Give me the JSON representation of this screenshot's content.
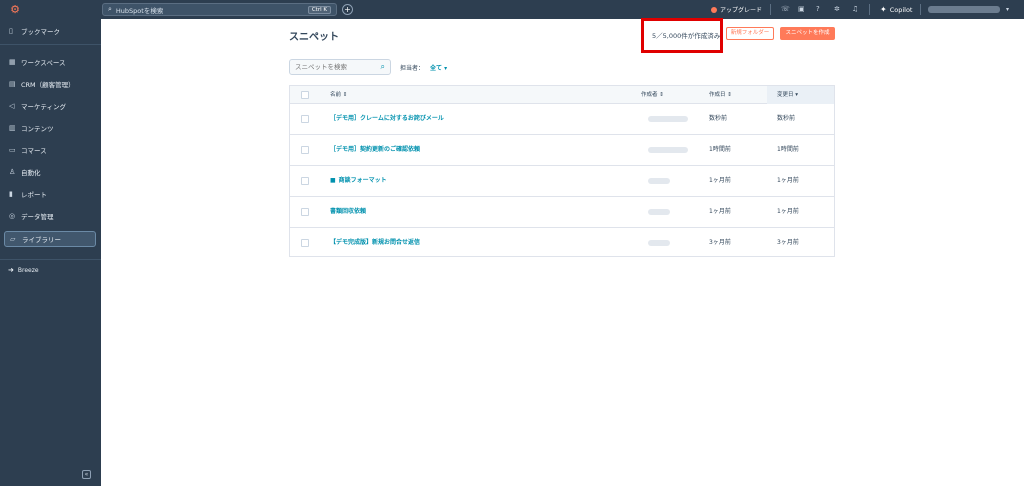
{
  "topbar": {
    "search_placeholder": "HubSpotを検索",
    "search_shortcut": "Ctrl K",
    "upgrade_label": "アップグレード",
    "copilot_label": "Copilot"
  },
  "sidebar": {
    "items": [
      {
        "label": "ブックマーク",
        "icon": "bookmark-icon"
      },
      {
        "label": "ワークスペース",
        "icon": "grid-icon"
      },
      {
        "label": "CRM（顧客管理）",
        "icon": "crm-icon"
      },
      {
        "label": "マーケティング",
        "icon": "megaphone-icon"
      },
      {
        "label": "コンテンツ",
        "icon": "content-icon"
      },
      {
        "label": "コマース",
        "icon": "commerce-icon"
      },
      {
        "label": "自動化",
        "icon": "automation-icon"
      },
      {
        "label": "レポート",
        "icon": "chart-icon"
      },
      {
        "label": "データ管理",
        "icon": "database-icon"
      },
      {
        "label": "ライブラリー",
        "icon": "folder-icon",
        "active": true
      }
    ],
    "breeze_label": "Breeze"
  },
  "main": {
    "title": "スニペット",
    "created_count": "5／5,000件が作成済み",
    "new_folder_label": "新規フォルダー",
    "create_snippet_label": "スニペットを作成",
    "search_placeholder": "スニペットを検索",
    "owner_label": "担当者：",
    "owner_value": "全て"
  },
  "table": {
    "headers": {
      "name": "名前",
      "creator": "作成者",
      "created": "作成日",
      "updated": "変更日"
    },
    "rows": [
      {
        "name": "［デモ用］クレームに対するお詫びメール",
        "created": "数秒前",
        "updated": "数秒前",
        "folder": false
      },
      {
        "name": "［デモ用］契約更新のご確認依頼",
        "created": "1時間前",
        "updated": "1時間前",
        "folder": false
      },
      {
        "name": "商談フォーマット",
        "created": "1ヶ月前",
        "updated": "1ヶ月前",
        "folder": true
      },
      {
        "name": "書類回収依頼",
        "created": "1ヶ月前",
        "updated": "1ヶ月前",
        "folder": false
      },
      {
        "name": "【デモ完成版】新規お問合せ返信",
        "created": "3ヶ月前",
        "updated": "3ヶ月前",
        "folder": false
      }
    ]
  },
  "colors": {
    "sidebar_bg": "#2d3e50",
    "accent": "#ff7a59",
    "link": "#0091ae",
    "highlight": "#e00000"
  }
}
